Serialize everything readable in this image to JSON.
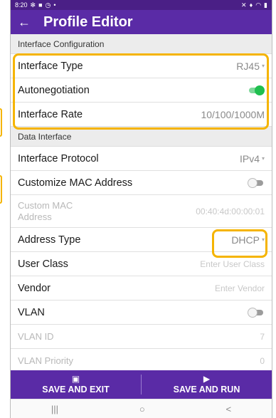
{
  "status_bar": {
    "time": "8:20",
    "left_icons": [
      "gear-icon",
      "image-icon",
      "clock-icon",
      "dot"
    ],
    "right_icons": [
      "mute-icon",
      "location-icon",
      "wifi-icon",
      "battery-icon"
    ]
  },
  "header": {
    "title": "Profile Editor"
  },
  "sections": {
    "interface_configuration": {
      "title": "Interface Configuration",
      "interface_type": {
        "label": "Interface Type",
        "value": "RJ45"
      },
      "autonegotiation": {
        "label": "Autonegotiation",
        "state": "on"
      },
      "interface_rate": {
        "label": "Interface Rate",
        "value": "10/100/1000M"
      }
    },
    "data_interface": {
      "title": "Data Interface",
      "interface_protocol": {
        "label": "Interface Protocol",
        "value": "IPv4"
      },
      "customize_mac": {
        "label": "Customize MAC Address",
        "state": "off"
      },
      "custom_mac": {
        "label_line1": "Custom MAC",
        "label_line2": "Address",
        "value": "00:40:4d:00:00:01"
      },
      "address_type": {
        "label": "Address Type",
        "value": "DHCP"
      },
      "user_class": {
        "label": "User Class",
        "placeholder": "Enter User Class"
      },
      "vendor": {
        "label": "Vendor",
        "placeholder": "Enter Vendor"
      },
      "vlan": {
        "label": "VLAN",
        "state": "off"
      },
      "vlan_id": {
        "label": "VLAN ID",
        "value": "7"
      },
      "vlan_priority": {
        "label": "VLAN Priority",
        "value": "0"
      }
    }
  },
  "actions": {
    "save_exit": "SAVE AND EXIT",
    "save_run": "SAVE AND RUN"
  },
  "nav": {
    "recent": "|||",
    "home": "○",
    "back": "<"
  },
  "colors": {
    "primary": "#5a2ba6",
    "highlight": "#f5b400",
    "toggle_on": "#1fbf4f"
  }
}
